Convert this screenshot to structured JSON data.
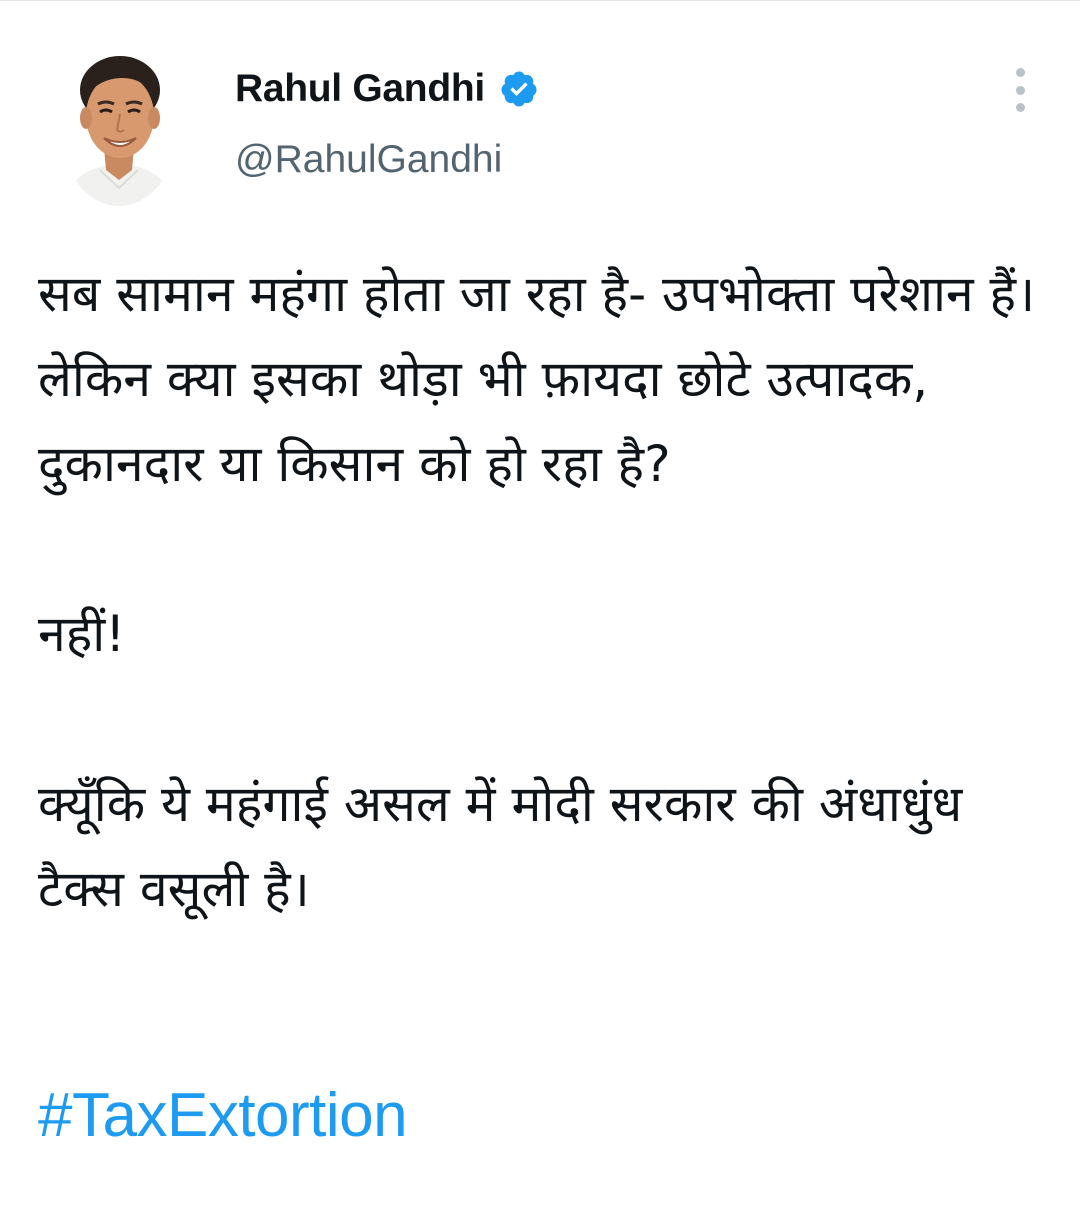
{
  "author": {
    "display_name": "Rahul Gandhi",
    "handle": "@RahulGandhi",
    "verified": true,
    "avatar": "profile-photo"
  },
  "tweet": {
    "paragraphs": [
      "सब सामान महंगा होता जा रहा है- उपभोक्ता परेशान हैं। लेकिन क्या इसका थोड़ा भी फ़ायदा छोटे उत्पादक, दुकानदार या किसान को हो रहा है?",
      "नहीं!",
      "क्यूँकि ये महंगाई असल में मोदी सरकार की अंधाधुंध टैक्स वसूली है।"
    ],
    "hashtag": "#TaxExtortion"
  },
  "icons": {
    "verified": "verified-badge-icon",
    "more": "more-options-icon"
  },
  "colors": {
    "link": "#1d9bf0",
    "secondary_text": "#536471",
    "primary_text": "#0f1419",
    "verified": "#1d9bf0"
  }
}
